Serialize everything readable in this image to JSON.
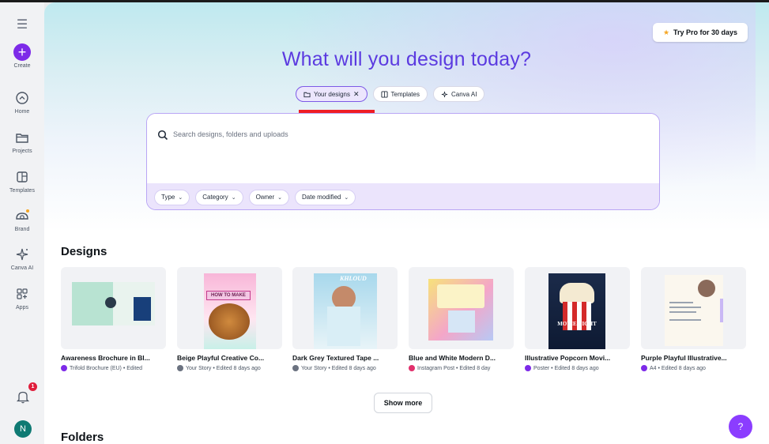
{
  "sidebar": {
    "create_label": "Create",
    "items": [
      {
        "label": "Home",
        "icon": "home-icon"
      },
      {
        "label": "Projects",
        "icon": "folder-icon"
      },
      {
        "label": "Templates",
        "icon": "templates-icon"
      },
      {
        "label": "Brand",
        "icon": "brand-icon"
      },
      {
        "label": "Canva AI",
        "icon": "sparkle-icon"
      },
      {
        "label": "Apps",
        "icon": "apps-icon"
      }
    ],
    "notification_count": "1",
    "avatar_initial": "N"
  },
  "header": {
    "try_pro_label": "Try Pro for 30 days",
    "title": "What will you design today?"
  },
  "tabs": [
    {
      "label": "Your designs",
      "active": true
    },
    {
      "label": "Templates",
      "active": false
    },
    {
      "label": "Canva AI",
      "active": false
    }
  ],
  "search": {
    "placeholder": "Search designs, folders and uploads",
    "filters": [
      "Type",
      "Category",
      "Owner",
      "Date modified"
    ]
  },
  "designs": {
    "section_title": "Designs",
    "items": [
      {
        "title": "Awareness Brochure in Bl...",
        "meta": "Trifold Brochure (EU) • Edited",
        "meta_color": "#7d2ae8"
      },
      {
        "title": "Beige Playful Creative Co...",
        "meta": "Your Story • Edited 8 days ago",
        "meta_color": "#6b7280"
      },
      {
        "title": "Dark Grey Textured Tape ...",
        "meta": "Your Story • Edited 8 days ago",
        "meta_color": "#6b7280"
      },
      {
        "title": "Blue and White Modern D...",
        "meta": "Instagram Post • Edited 8 day",
        "meta_color": "#e1306c"
      },
      {
        "title": "Illustrative Popcorn Movi...",
        "meta": "Poster • Edited 8 days ago",
        "meta_color": "#7d2ae8"
      },
      {
        "title": "Purple Playful Illustrative...",
        "meta": "A4 • Edited 8 days ago",
        "meta_color": "#7d2ae8"
      }
    ],
    "show_more_label": "Show more"
  },
  "folders": {
    "section_title": "Folders"
  },
  "help_label": "?",
  "thumb_text": {
    "how_to_make": "HOW TO MAKE",
    "khloud": "KHLOUD",
    "movie_night": "MOVIE NIGHT"
  },
  "colors": {
    "accent": "#7d2ae8",
    "title": "#5b3ae0",
    "underline": "#ef1d24"
  }
}
